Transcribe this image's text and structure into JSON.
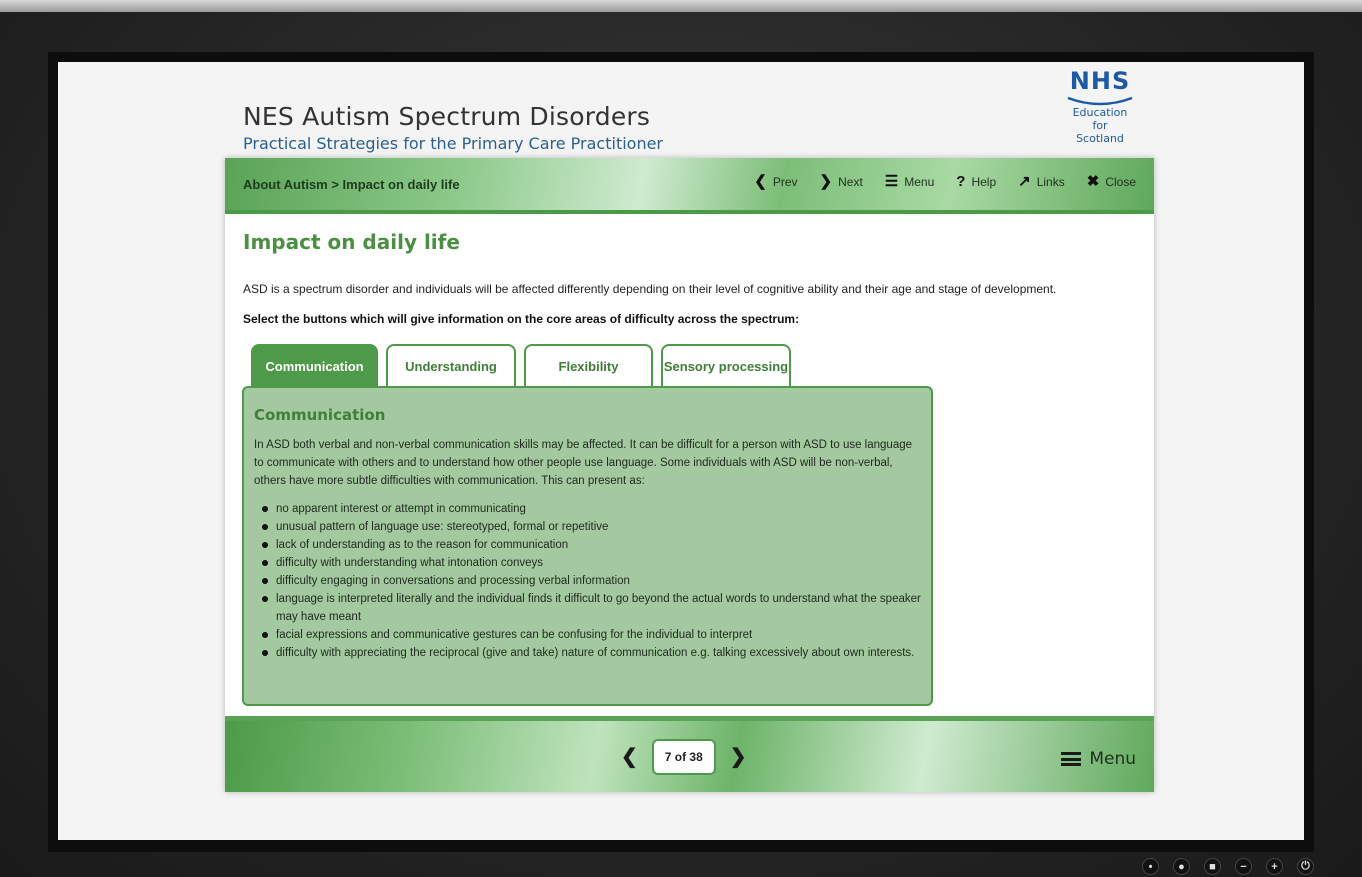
{
  "header": {
    "title": "NES Autism Spectrum Disorders",
    "subtitle": "Practical Strategies for the Primary Care Practitioner",
    "logo": {
      "mark": "NHS",
      "line1": "Education",
      "line2": "for",
      "line3": "Scotland"
    }
  },
  "topbar": {
    "breadcrumb": "About Autism > Impact on daily life",
    "prev": "Prev",
    "next": "Next",
    "menu": "Menu",
    "help": "Help",
    "links": "Links",
    "close": "Close"
  },
  "page": {
    "heading": "Impact on daily life",
    "intro": "ASD is a spectrum disorder and individuals will be affected differently depending on their level of cognitive ability and their age and stage of development.",
    "instruction": "Select the buttons which will give information on the core areas of difficulty across the spectrum:"
  },
  "tabs": [
    {
      "label": "Communication",
      "active": true
    },
    {
      "label": "Understanding",
      "active": false
    },
    {
      "label": "Flexibility",
      "active": false
    },
    {
      "label": "Sensory processing",
      "active": false
    }
  ],
  "panel": {
    "title": "Communication",
    "body": "In ASD both verbal and non-verbal communication skills may be affected. It can be difficult for a person with ASD to use language to communicate with others and to understand how other people use language. Some individuals with ASD will be non-verbal, others have more subtle difficulties with communication. This can present as:",
    "items": [
      "no apparent interest or attempt in communicating",
      "unusual pattern of language use: stereotyped, formal or repetitive",
      "lack of understanding as to the reason for communication",
      "difficulty with understanding what intonation conveys",
      "difficulty engaging in conversations and processing verbal information",
      "language is interpreted literally and the individual finds it difficult to go beyond the actual words to understand what the speaker may have meant",
      "facial expressions and communicative gestures can be confusing for the individual to interpret",
      "difficulty with appreciating the reciprocal (give and take) nature of communication e.g. talking excessively about own interests."
    ]
  },
  "footer": {
    "page_indicator": "7 of 38",
    "menu": "Menu"
  },
  "colors": {
    "accent_green": "#4f9a4a",
    "panel_green": "#a4c8a0",
    "subtitle_blue": "#2b5f93",
    "nhs_blue": "#1d5aa6"
  }
}
